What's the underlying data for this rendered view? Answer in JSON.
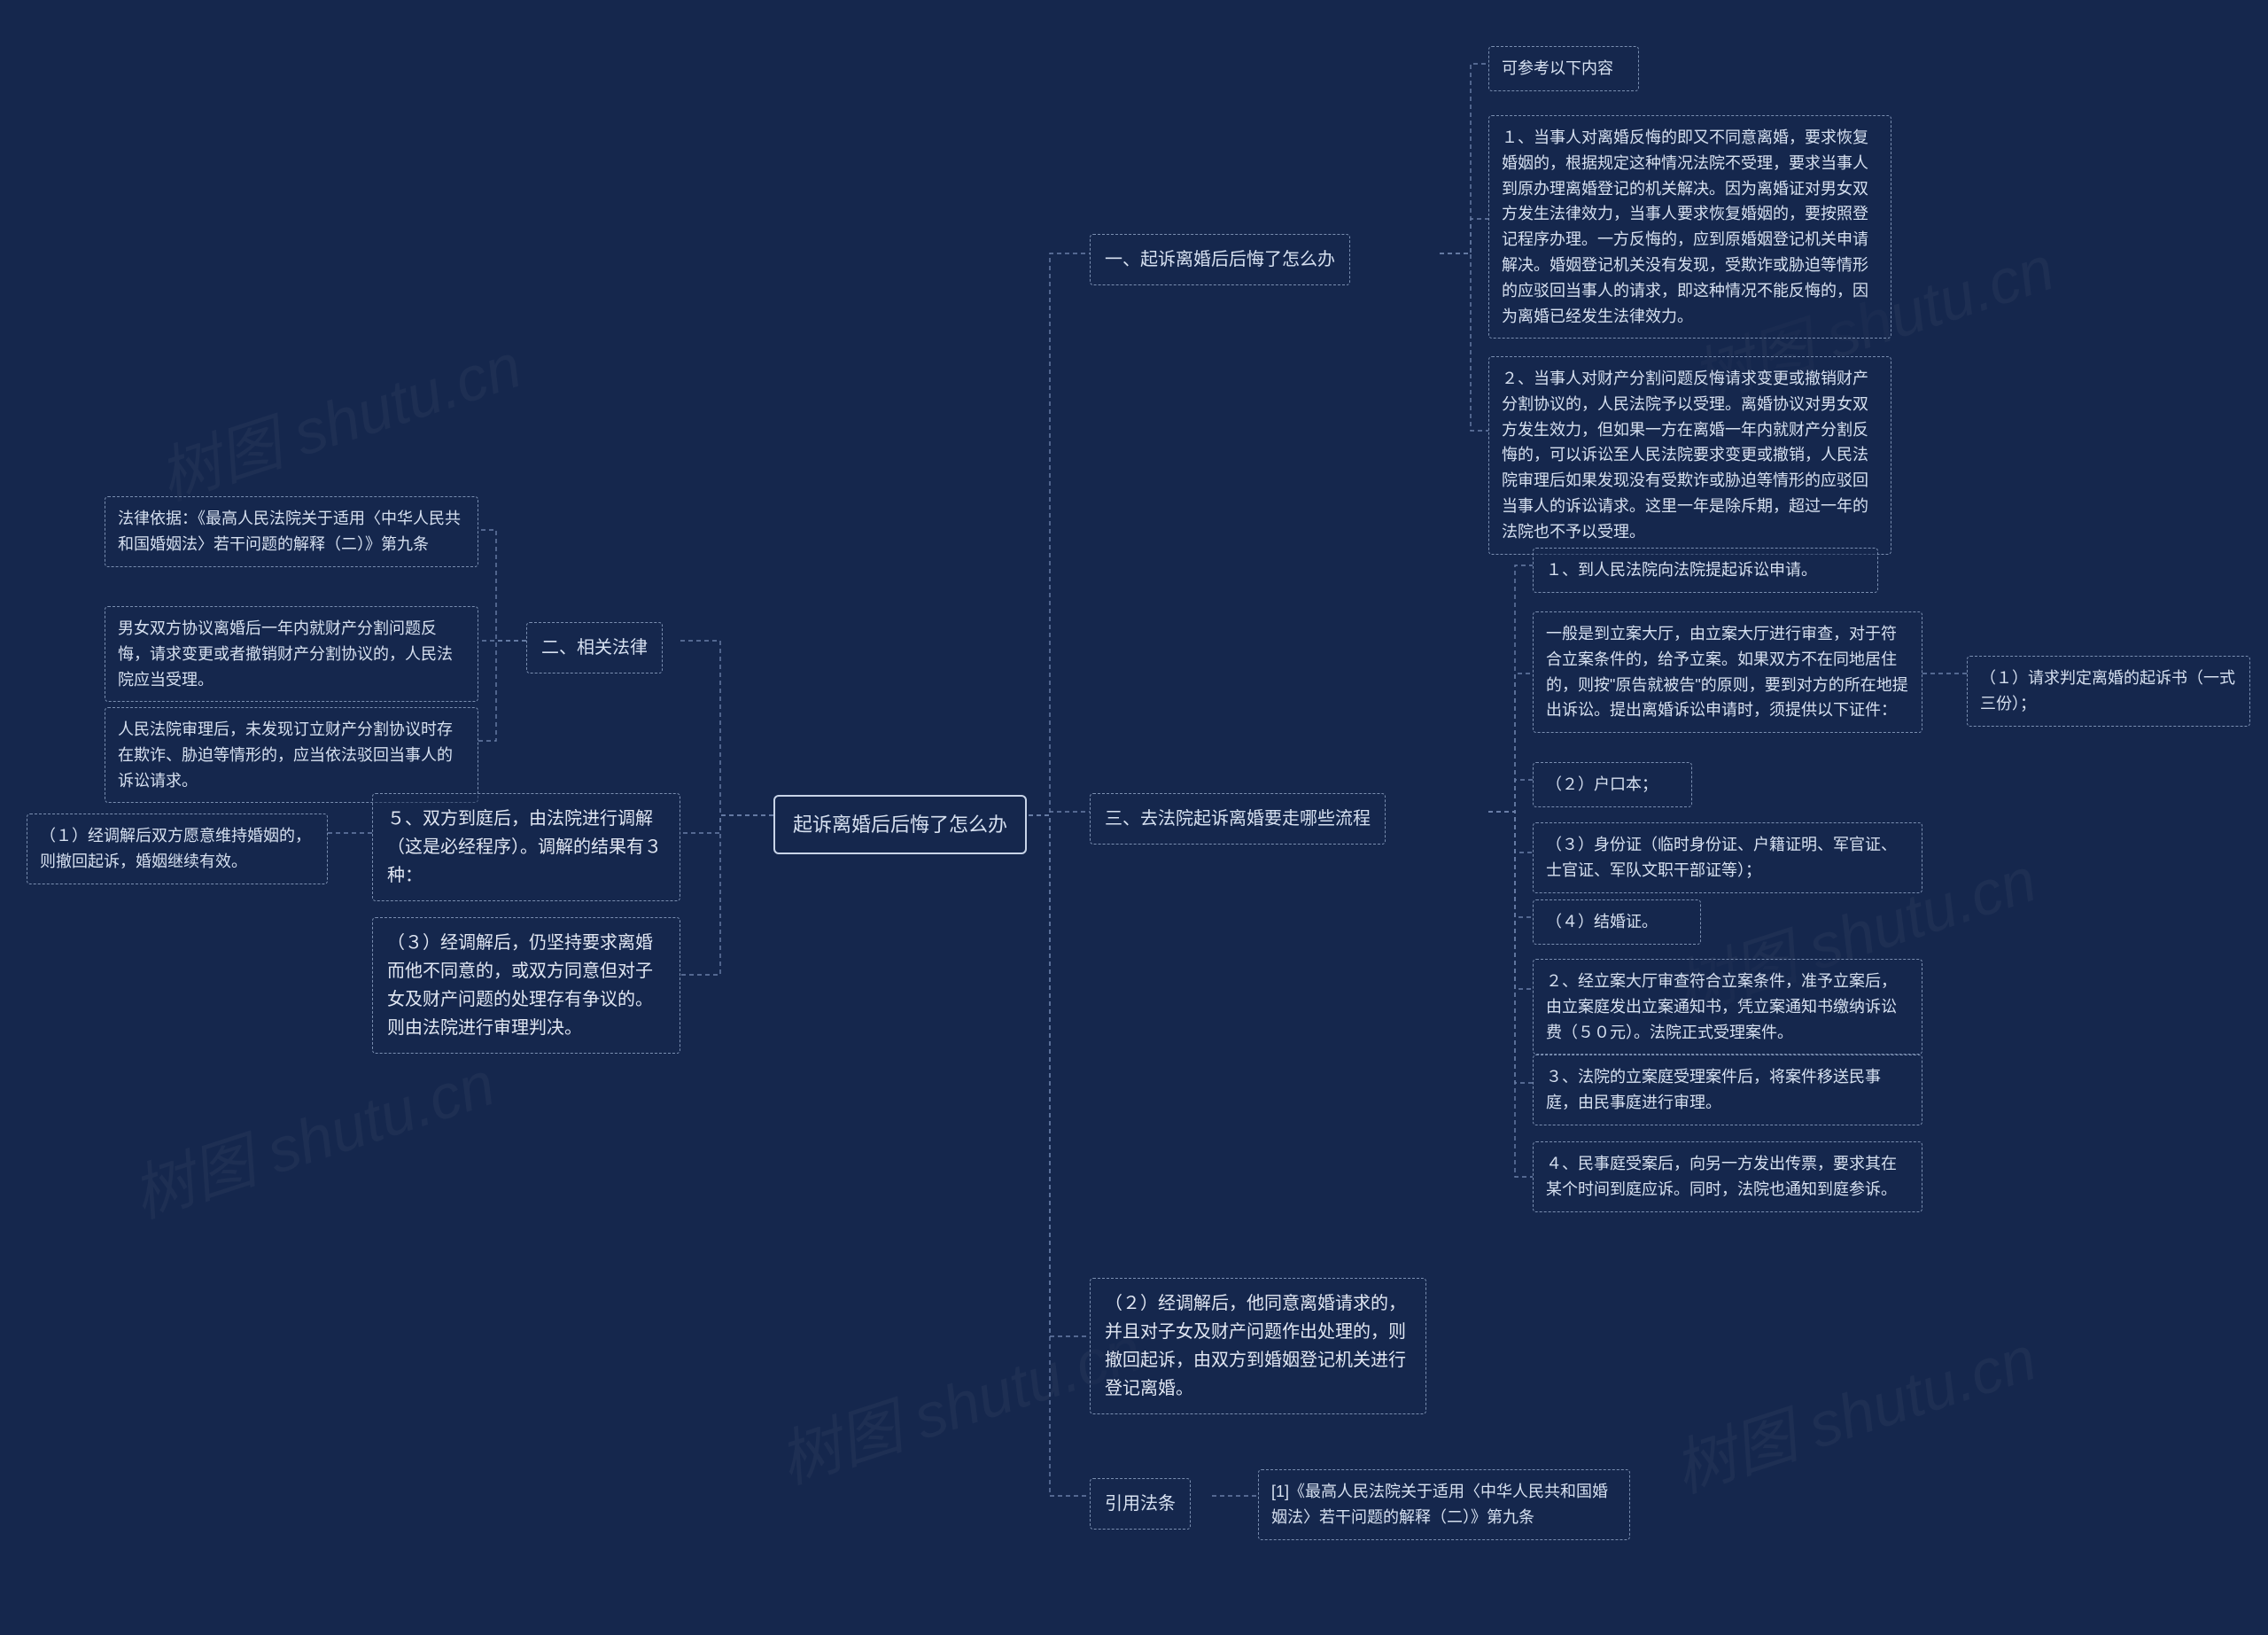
{
  "watermark": "树图 shutu.cn",
  "center": "起诉离婚后后悔了怎么办",
  "s1": {
    "title": "一、起诉离婚后后悔了怎么办",
    "a": "可参考以下内容",
    "b": "１、当事人对离婚反悔的即又不同意离婚，要求恢复婚姻的，根据规定这种情况法院不受理，要求当事人到原办理离婚登记的机关解决。因为离婚证对男女双方发生法律效力，当事人要求恢复婚姻的，要按照登记程序办理。一方反悔的，应到原婚姻登记机关申请解决。婚姻登记机关没有发现，受欺诈或胁迫等情形的应驳回当事人的请求，即这种情况不能反悔的，因为离婚已经发生法律效力。",
    "c": "２、当事人对财产分割问题反悔请求变更或撤销财产分割协议的，人民法院予以受理。离婚协议对男女双方发生效力，但如果一方在离婚一年内就财产分割反悔的，可以诉讼至人民法院要求变更或撤销，人民法院审理后如果发现没有受欺诈或胁迫等情形的应驳回当事人的诉讼请求。这里一年是除斥期，超过一年的法院也不予以受理。"
  },
  "s2": {
    "title": "二、相关法律",
    "a": "法律依据：《最高人民法院关于适用〈中华人民共和国婚姻法〉若干问题的解释（二）》第九条",
    "b": "男女双方协议离婚后一年内就财产分割问题反悔，请求变更或者撤销财产分割协议的，人民法院应当受理。",
    "c": "人民法院审理后，未发现订立财产分割协议时存在欺诈、胁迫等情形的，应当依法驳回当事人的诉讼请求。"
  },
  "s3": {
    "title": "三、去法院起诉离婚要走哪些流程",
    "a": "１、到人民法院向法院提起诉讼申请。",
    "b": "一般是到立案大厅，由立案大厅进行审查，对于符合立案条件的，给予立案。如果双方不在同地居住的，则按\"原告就被告\"的原则，要到对方的所在地提出诉讼。提出离婚诉讼申请时，须提供以下证件：",
    "b1": "（１）请求判定离婚的起诉书（一式三份）；",
    "b2": "（２）户口本；",
    "b3": "（３）身份证（临时身份证、户籍证明、军官证、士官证、军队文职干部证等）；",
    "b4": "（４）结婚证。",
    "c": "２、经立案大厅审查符合立案条件，准予立案后，由立案庭发出立案通知书，凭立案通知书缴纳诉讼费（５０元）。法院正式受理案件。",
    "d": "３、法院的立案庭受理案件后，将案件移送民事庭，由民事庭进行审理。",
    "e": "４、民事庭受案后，向另一方发出传票，要求其在某个时间到庭应诉。同时，法院也通知到庭参诉。"
  },
  "s4": {
    "title": "５、双方到庭后，由法院进行调解（这是必经程序）。调解的结果有３种：",
    "a": "（１）经调解后双方愿意维持婚姻的，则撤回起诉，婚姻继续有效。",
    "b": "（２）经调解后，他同意离婚请求的，并且对子女及财产问题作出处理的，则撤回起诉，由双方到婚姻登记机关进行登记离婚。",
    "c": "（３）经调解后，仍坚持要求离婚而他不同意的，或双方同意但对子女及财产问题的处理存有争议的。则由法院进行审理判决。"
  },
  "s5": {
    "title": "引用法条",
    "a": "[1]《最高人民法院关于适用〈中华人民共和国婚姻法〉若干问题的解释（二）》第九条"
  }
}
